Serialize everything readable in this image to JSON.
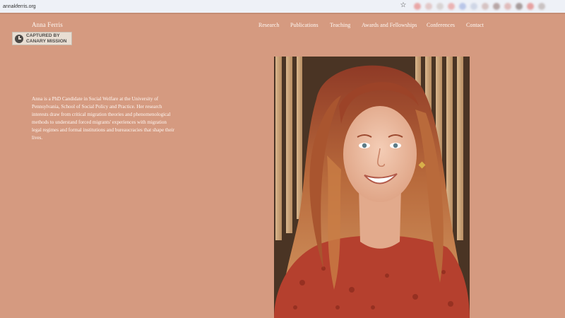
{
  "browser": {
    "url": "annakferris.org",
    "star_glyph": "☆"
  },
  "site": {
    "name": "Anna Ferris"
  },
  "badge": {
    "line1": "CAPTURED BY",
    "line2": "CANARY MISSION"
  },
  "nav": {
    "items": [
      {
        "label": "Research"
      },
      {
        "label": "Publications"
      },
      {
        "label": "Teaching"
      },
      {
        "label": "Awards and Fellowships"
      },
      {
        "label": "Conferences"
      },
      {
        "label": "Contact"
      }
    ]
  },
  "bio": {
    "text": "Anna is a PhD Candidate in Social Welfare at the University of Pennsylvania, School of Social Policy and Practice. Her research interests draw from critical migration theories and phenomenological methods to understand forced migrants' experiences with migration legal regimes and formal institutions and bureaucracies that shape their lives."
  },
  "photo": {
    "icon": "portrait-photo"
  },
  "colors": {
    "page_background": "#d59a80",
    "text": "#fff8f3",
    "badge_background": "#e8ded3",
    "badge_text": "#4d4a47",
    "browser_bar": "#eef1f7"
  }
}
